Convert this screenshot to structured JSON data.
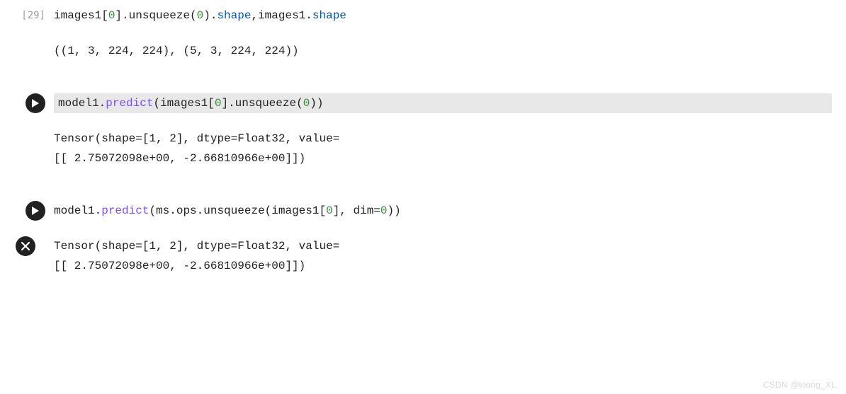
{
  "cells": [
    {
      "exec_count": "[29]",
      "code_tokens": [
        {
          "t": "images1[",
          "c": "plain"
        },
        {
          "t": "0",
          "c": "num"
        },
        {
          "t": "].unsqueeze(",
          "c": "plain"
        },
        {
          "t": "0",
          "c": "num"
        },
        {
          "t": ").",
          "c": "plain"
        },
        {
          "t": "shape",
          "c": "attr"
        },
        {
          "t": ",images1.",
          "c": "plain"
        },
        {
          "t": "shape",
          "c": "attr"
        }
      ],
      "output": [
        "((1, 3, 224, 224), (5, 3, 224, 224))"
      ]
    },
    {
      "code_tokens": [
        {
          "t": "model1.",
          "c": "plain"
        },
        {
          "t": "predict",
          "c": "func"
        },
        {
          "t": "(images1[",
          "c": "plain"
        },
        {
          "t": "0",
          "c": "num"
        },
        {
          "t": "].unsqueeze(",
          "c": "plain"
        },
        {
          "t": "0",
          "c": "num"
        },
        {
          "t": "))",
          "c": "plain"
        }
      ],
      "output": [
        "Tensor(shape=[1, 2], dtype=Float32, value=",
        "[[ 2.75072098e+00, -2.66810966e+00]])"
      ]
    },
    {
      "code_tokens": [
        {
          "t": "model1.",
          "c": "plain"
        },
        {
          "t": "predict",
          "c": "func"
        },
        {
          "t": "(ms.ops.unsqueeze(images1[",
          "c": "plain"
        },
        {
          "t": "0",
          "c": "num"
        },
        {
          "t": "], dim=",
          "c": "plain"
        },
        {
          "t": "0",
          "c": "num"
        },
        {
          "t": "))",
          "c": "plain"
        }
      ],
      "output": [
        "Tensor(shape=[1, 2], dtype=Float32, value=",
        "[[ 2.75072098e+00, -2.66810966e+00]])"
      ],
      "error": true
    }
  ],
  "icons": {
    "play": "play-icon",
    "error": "error-icon"
  },
  "watermark": "CSDN @loong_XL"
}
